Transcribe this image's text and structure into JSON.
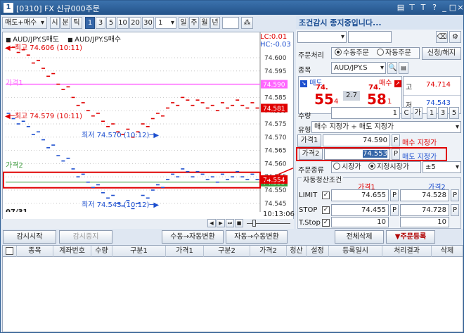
{
  "window": {
    "app_number": "1",
    "title": "[0310] FX 신규000주문",
    "controls": [
      "미니",
      "고정",
      "T",
      "?",
      "_",
      "□",
      "×"
    ]
  },
  "toolbar": {
    "side_select": "매도+매수",
    "period_buttons": [
      "시",
      "분",
      "틱"
    ],
    "intervals": [
      "1",
      "3",
      "5",
      "10",
      "20",
      "30"
    ],
    "interval_select": "1",
    "day_buttons": [
      "일",
      "주",
      "월",
      "년"
    ],
    "selected_interval": "1"
  },
  "chart": {
    "legend_sell": "AUD/JPY.S매도",
    "legend_buy": "AUD/JPY.S매수",
    "lc_label": "LC:0.01",
    "hc_label": "HC:-0.03",
    "price1_label": "가격1",
    "price2_label": "가격2",
    "price1_line_value": "74.590",
    "price2_line_value": "74.553",
    "current_sell": "74.581",
    "current_buy": "74.554",
    "ann_high1": "최고 74.606 (10:11)",
    "ann_high2": "최고 74.579 (10:11)",
    "ann_low1": "최저 74.570 (10:12)",
    "ann_low2": "최저 74.543 (10:12)",
    "date": "07/31",
    "time": "10:13:06",
    "colors": {
      "sell": "#e00000",
      "buy": "#1d4fcf",
      "price1": "#ff66ff",
      "price2": "#3a9a3a",
      "highlight": "#e00000"
    }
  },
  "chart_data": {
    "type": "line",
    "title": "",
    "xlabel": "",
    "ylabel": "",
    "ylim": [
      74.54,
      74.605
    ],
    "y_ticks": [
      "74.600",
      "74.595",
      "74.590",
      "74.585",
      "74.580",
      "74.575",
      "74.570",
      "74.565",
      "74.560",
      "74.555",
      "74.550",
      "74.545"
    ],
    "series": [
      {
        "name": "AUD/JPY.S매도",
        "values": [
          74.606,
          74.604,
          74.602,
          74.603,
          74.601,
          74.598,
          74.599,
          74.596,
          74.593,
          74.594,
          74.59,
          74.588,
          74.589,
          74.585,
          74.582,
          74.583,
          74.58,
          74.578,
          74.579,
          74.576,
          74.574,
          74.575,
          74.572,
          74.571,
          74.573,
          74.57,
          74.572,
          74.575,
          74.574,
          74.577,
          74.579,
          74.578,
          74.581,
          74.583,
          74.582,
          74.585,
          74.584,
          74.582,
          74.584,
          74.583,
          74.581,
          74.582,
          74.58,
          74.583,
          74.581,
          74.582,
          74.584,
          74.582,
          74.581,
          74.583,
          74.581
        ]
      },
      {
        "name": "AUD/JPY.S매수",
        "values": [
          74.579,
          74.577,
          74.575,
          74.576,
          74.574,
          74.571,
          74.572,
          74.569,
          74.566,
          74.567,
          74.563,
          74.561,
          74.562,
          74.558,
          74.555,
          74.556,
          74.553,
          74.551,
          74.552,
          74.549,
          74.547,
          74.548,
          74.545,
          74.544,
          74.546,
          74.543,
          74.545,
          74.548,
          74.547,
          74.55,
          74.552,
          74.551,
          74.554,
          74.556,
          74.555,
          74.558,
          74.557,
          74.555,
          74.557,
          74.556,
          74.554,
          74.555,
          74.553,
          74.556,
          74.554,
          74.555,
          74.557,
          74.555,
          74.554,
          74.556,
          74.554
        ]
      }
    ]
  },
  "left_buttons": {
    "start": "감시시작",
    "stop": "감시중지",
    "manual_to_auto": "수동→자동변환",
    "auto_to_manual": "자동→수동변환"
  },
  "right_panel": {
    "title": "조건감시 종지중입니다...",
    "order_type_label": "주문처리",
    "manual": "수동주문",
    "auto": "자동주문",
    "new_clear": "신청/해지",
    "symbol_label": "종목",
    "symbol": "AUD/JPY.S",
    "sell_label": "매도",
    "buy_label": "매수",
    "sell_price_small": "74.",
    "sell_price_big": "55",
    "sell_price_sub": "4",
    "buy_price_small": "74.",
    "buy_price_big": "58",
    "buy_price_sub": "1",
    "spread": "2.7",
    "high_label": "고",
    "high_value": "74.714",
    "low_label": "저",
    "low_value": "74.543",
    "qty_label": "수량",
    "qty_value": "1",
    "qty_btns": [
      "C",
      "가",
      "1",
      "3",
      "5"
    ],
    "type_label": "유형",
    "type_value": "매수 지정가 + 매도 지정가",
    "price1_label": "가격1",
    "price1_value": "74.590",
    "price1_p": "P",
    "price1_desc": "매수 지정가",
    "price2_label": "가격2",
    "price2_value": "74.553",
    "price2_p": "P",
    "price2_desc": "매도 지정가",
    "order_kind_label": "주문종류",
    "market": "시장가",
    "limit_market": "지정시장가",
    "slip": "±5",
    "clear_group": "자동청산조건",
    "col_price1": "가격1",
    "col_price2": "가격2",
    "limit_label": "LIMIT",
    "limit_p1": "74.655",
    "limit_p2": "74.528",
    "stop_label": "STOP",
    "stop_p1": "74.455",
    "stop_p2": "74.728",
    "tstop_label": "T.Stop",
    "tstop_p1": "10",
    "tstop_p2": "10",
    "delete_all": "전체삭제",
    "register": "▼주문등록"
  },
  "grid": {
    "columns": [
      "종목",
      "계좌번호",
      "수량",
      "구분1",
      "가격1",
      "구분2",
      "가격2",
      "청산",
      "설정",
      "등록일시",
      "처리결과",
      "삭제"
    ]
  }
}
